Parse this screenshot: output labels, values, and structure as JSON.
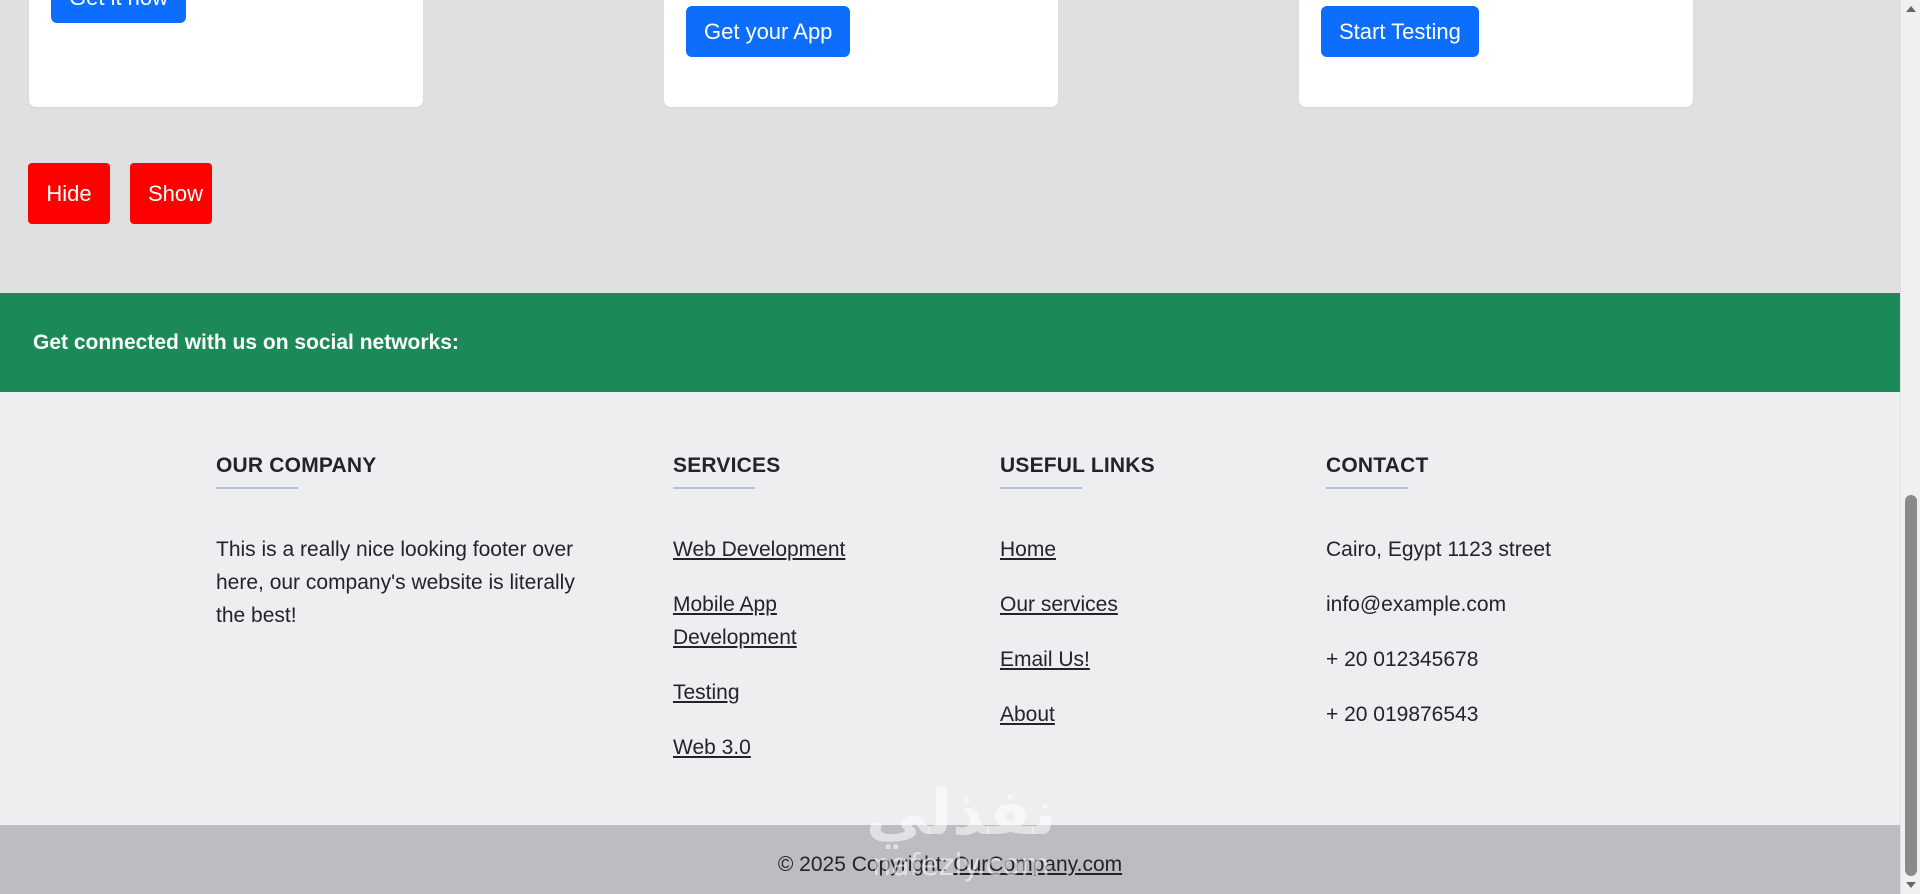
{
  "cards": [
    {
      "button_label": "Get it now"
    },
    {
      "button_label": "Get your App"
    },
    {
      "button_label": "Start Testing"
    }
  ],
  "toggle_buttons": {
    "hide_label": "Hide",
    "show_label": "Show"
  },
  "social_bar": {
    "text": "Get connected with us on social networks:"
  },
  "footer": {
    "company": {
      "heading": "OUR COMPANY",
      "description": "This is a really nice looking footer over here, our company's website is literally the best!"
    },
    "services": {
      "heading": "SERVICES",
      "links": [
        "Web Development",
        "Mobile App Development",
        "Testing",
        "Web 3.0"
      ]
    },
    "useful_links": {
      "heading": "USEFUL LINKS",
      "links": [
        "Home",
        "Our services",
        "Email Us!",
        "About"
      ]
    },
    "contact": {
      "heading": "CONTACT",
      "address": "Cairo, Egypt 1123 street",
      "email": "info@example.com",
      "phone1": "+ 20 012345678",
      "phone2": "+ 20 019876543"
    }
  },
  "copyright": {
    "prefix": "© 2025 Copyright: ",
    "link": "OurCompany.com"
  },
  "watermark": {
    "arabic": "نفذلي",
    "latin": "nafezly.com"
  },
  "colors": {
    "primary_button": "#0d6efd",
    "red_button": "#ff0000",
    "social_bar": "#1b8a57",
    "footer_bg": "#eceef0",
    "copyright_bg": "#bcbdc0"
  }
}
